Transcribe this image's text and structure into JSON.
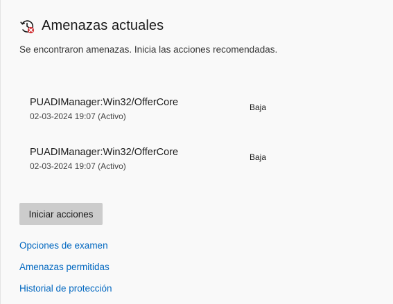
{
  "header": {
    "icon": "threat-history-icon",
    "title": "Amenazas actuales"
  },
  "subtitle": "Se encontraron amenazas. Inicia las acciones recomendadas.",
  "threats": [
    {
      "name": "PUADIManager:Win32/OfferCore",
      "date": "02-03-2024 19:07 (Activo)",
      "level": "Baja"
    },
    {
      "name": "PUADIManager:Win32/OfferCore",
      "date": "02-03-2024 19:07 (Activo)",
      "level": "Baja"
    }
  ],
  "actions": {
    "start_label": "Iniciar acciones"
  },
  "links": {
    "scan_options": "Opciones de examen",
    "allowed_threats": "Amenazas permitidas",
    "protection_history": "Historial de protección"
  },
  "colors": {
    "link": "#0067c0",
    "button_bg": "#cccccc",
    "alert": "#d13438"
  }
}
